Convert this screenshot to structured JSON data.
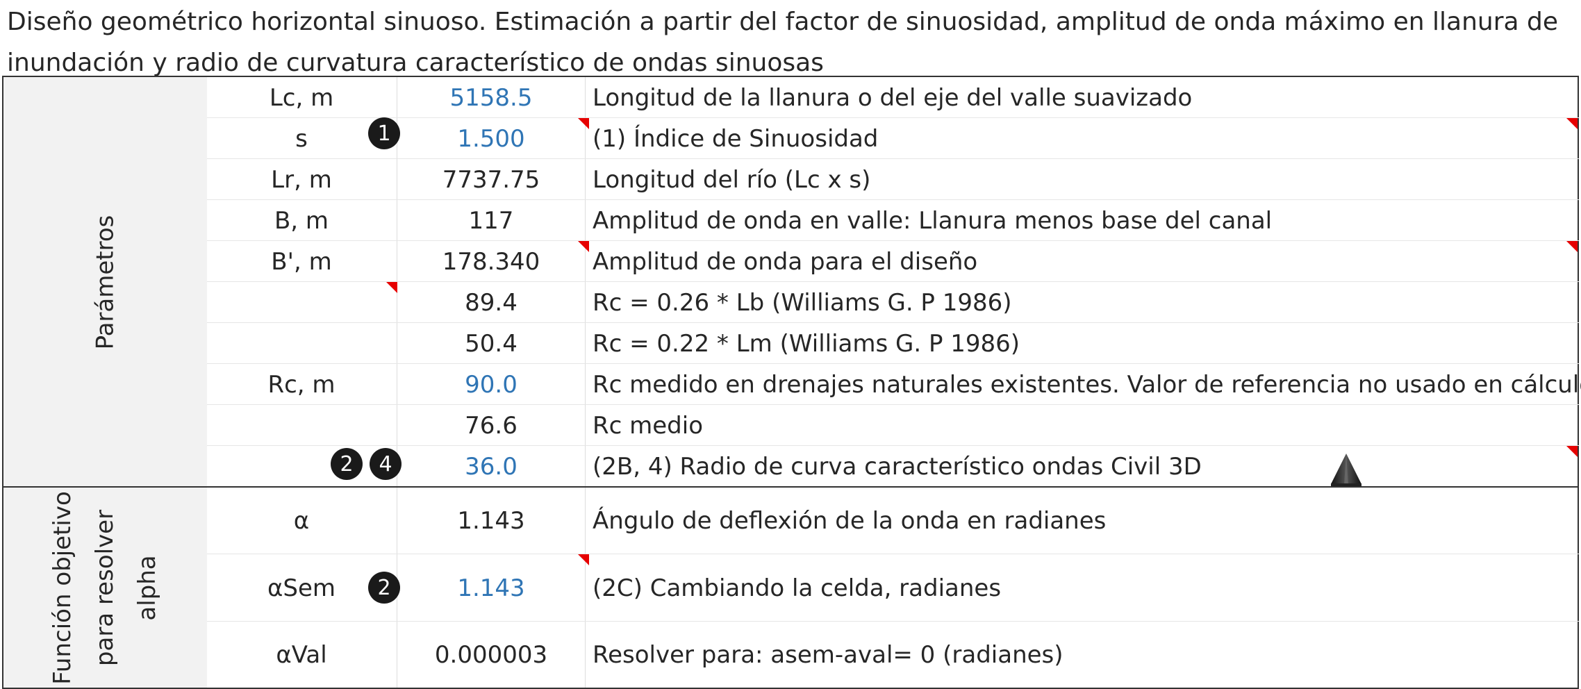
{
  "title": "Diseño geométrico horizontal sinuoso. Estimación a partir del factor de sinuosidad, amplitud de onda máximo en llanura de inundación y radio de curvatura característico de ondas sinuosas",
  "section1": {
    "label": "Parámetros",
    "rows": [
      {
        "name": "Lc, m",
        "value": "5158.5",
        "desc": "Longitud de la llanura o del eje del valle suavizado"
      },
      {
        "name": "s",
        "value": "1.500",
        "desc": "(1) Índice de Sinuosidad"
      },
      {
        "name": "Lr, m",
        "value": "7737.75",
        "desc": "Longitud del río (Lc x s)"
      },
      {
        "name": "B, m",
        "value": "117",
        "desc": "Amplitud de onda en valle: Llanura menos base del canal"
      },
      {
        "name": "B', m",
        "value": "178.340",
        "desc": "Amplitud de onda para el diseño"
      },
      {
        "name": "",
        "value": "89.4",
        "desc": "Rc = 0.26 * Lb (Williams G. P 1986)"
      },
      {
        "name": "",
        "value": "50.4",
        "desc": "Rc = 0.22 * Lm (Williams G. P 1986)"
      },
      {
        "name": "Rc, m",
        "value": "90.0",
        "desc": "Rc medido en drenajes naturales existentes. Valor de referencia no usado en cálculos"
      },
      {
        "name": "",
        "value": "76.6",
        "desc": "Rc medio"
      },
      {
        "name": "",
        "value": "36.0",
        "desc": "(2B, 4) Radio de curva característico ondas Civil 3D"
      }
    ],
    "badges": [
      "1",
      "2",
      "4"
    ]
  },
  "section2": {
    "label_lines": [
      "Función objetivo",
      "para resolver",
      "alpha"
    ],
    "rows": [
      {
        "name": "α",
        "value": "1.143",
        "desc": "Ángulo de deflexión de la onda en radianes"
      },
      {
        "name": "αSem",
        "value": "1.143",
        "desc": "(2C) Cambiando la celda, radianes"
      },
      {
        "name": "αVal",
        "value": "0.000003",
        "desc": "Resolver para: asem-aval= 0 (radianes)"
      }
    ],
    "badges": [
      "2"
    ]
  },
  "colors": {
    "input_blue": "#2f75b5",
    "comment_red": "#e60000",
    "band_gray": "#f2f2f2",
    "badge_black": "#1a1a1a"
  },
  "icons": [
    "civil3d-cone-icon"
  ]
}
